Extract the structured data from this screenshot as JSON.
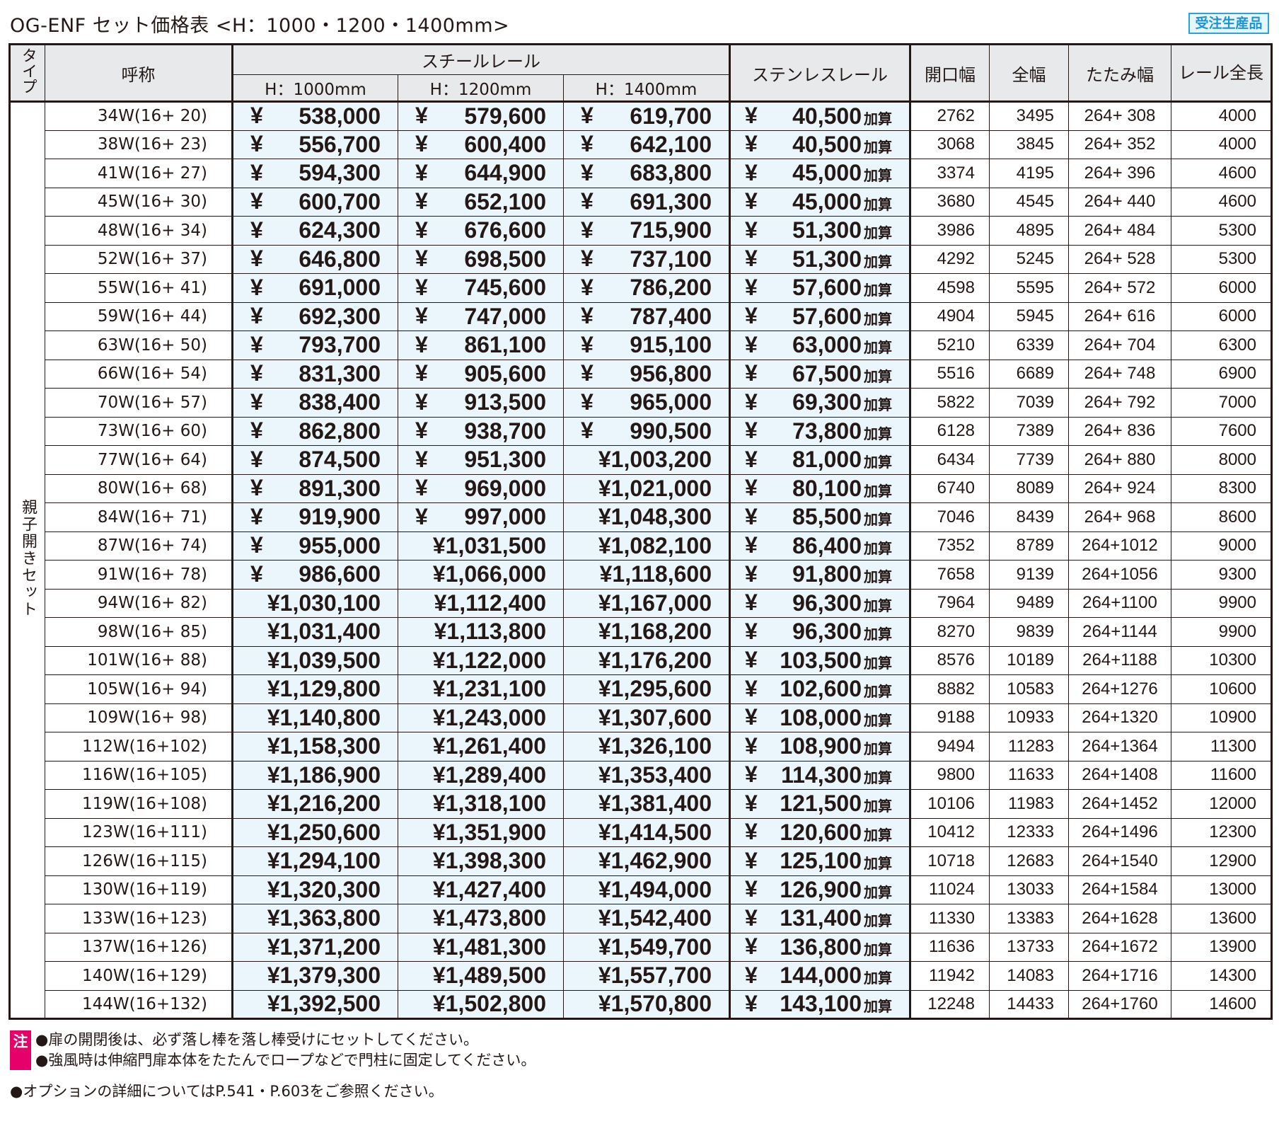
{
  "title": "OG-ENF セット価格表 <H：1000・1200・1400mm>",
  "badge": "受注生産品",
  "header": {
    "type": "タイプ",
    "name": "呼称",
    "steel_rail": "スチールレール",
    "h1000": "H：1000mm",
    "h1200": "H：1200mm",
    "h1400": "H：1400mm",
    "stainless_rail": "ステンレスレール",
    "opening_width": "開口幅",
    "total_width": "全幅",
    "folded_width": "たたみ幅",
    "rail_length": "レール全長"
  },
  "type_label": "親子開きセット",
  "currency": "¥",
  "kasan": "加算",
  "rows": [
    {
      "name": "34W(16+ 20)",
      "h1000": "538,000",
      "h1200": "579,600",
      "h1400": "619,700",
      "stainless": "40,500",
      "opening": "2762",
      "total": "3495",
      "folded": "264+ 308",
      "rail": "4000"
    },
    {
      "name": "38W(16+ 23)",
      "h1000": "556,700",
      "h1200": "600,400",
      "h1400": "642,100",
      "stainless": "40,500",
      "opening": "3068",
      "total": "3845",
      "folded": "264+ 352",
      "rail": "4000"
    },
    {
      "name": "41W(16+ 27)",
      "h1000": "594,300",
      "h1200": "644,900",
      "h1400": "683,800",
      "stainless": "45,000",
      "opening": "3374",
      "total": "4195",
      "folded": "264+ 396",
      "rail": "4600"
    },
    {
      "name": "45W(16+ 30)",
      "h1000": "600,700",
      "h1200": "652,100",
      "h1400": "691,300",
      "stainless": "45,000",
      "opening": "3680",
      "total": "4545",
      "folded": "264+ 440",
      "rail": "4600"
    },
    {
      "name": "48W(16+ 34)",
      "h1000": "624,300",
      "h1200": "676,600",
      "h1400": "715,900",
      "stainless": "51,300",
      "opening": "3986",
      "total": "4895",
      "folded": "264+ 484",
      "rail": "5300"
    },
    {
      "name": "52W(16+ 37)",
      "h1000": "646,800",
      "h1200": "698,500",
      "h1400": "737,100",
      "stainless": "51,300",
      "opening": "4292",
      "total": "5245",
      "folded": "264+ 528",
      "rail": "5300"
    },
    {
      "name": "55W(16+ 41)",
      "h1000": "691,000",
      "h1200": "745,600",
      "h1400": "786,200",
      "stainless": "57,600",
      "opening": "4598",
      "total": "5595",
      "folded": "264+ 572",
      "rail": "6000"
    },
    {
      "name": "59W(16+ 44)",
      "h1000": "692,300",
      "h1200": "747,000",
      "h1400": "787,400",
      "stainless": "57,600",
      "opening": "4904",
      "total": "5945",
      "folded": "264+ 616",
      "rail": "6000"
    },
    {
      "name": "63W(16+ 50)",
      "h1000": "793,700",
      "h1200": "861,100",
      "h1400": "915,100",
      "stainless": "63,000",
      "opening": "5210",
      "total": "6339",
      "folded": "264+ 704",
      "rail": "6300"
    },
    {
      "name": "66W(16+ 54)",
      "h1000": "831,300",
      "h1200": "905,600",
      "h1400": "956,800",
      "stainless": "67,500",
      "opening": "5516",
      "total": "6689",
      "folded": "264+ 748",
      "rail": "6900"
    },
    {
      "name": "70W(16+ 57)",
      "h1000": "838,400",
      "h1200": "913,500",
      "h1400": "965,000",
      "stainless": "69,300",
      "opening": "5822",
      "total": "7039",
      "folded": "264+ 792",
      "rail": "7000"
    },
    {
      "name": "73W(16+ 60)",
      "h1000": "862,800",
      "h1200": "938,700",
      "h1400": "990,500",
      "stainless": "73,800",
      "opening": "6128",
      "total": "7389",
      "folded": "264+ 836",
      "rail": "7600"
    },
    {
      "name": "77W(16+ 64)",
      "h1000": "874,500",
      "h1200": "951,300",
      "h1400": "1,003,200",
      "stainless": "81,000",
      "opening": "6434",
      "total": "7739",
      "folded": "264+ 880",
      "rail": "8000"
    },
    {
      "name": "80W(16+ 68)",
      "h1000": "891,300",
      "h1200": "969,000",
      "h1400": "1,021,000",
      "stainless": "80,100",
      "opening": "6740",
      "total": "8089",
      "folded": "264+ 924",
      "rail": "8300"
    },
    {
      "name": "84W(16+ 71)",
      "h1000": "919,900",
      "h1200": "997,000",
      "h1400": "1,048,300",
      "stainless": "85,500",
      "opening": "7046",
      "total": "8439",
      "folded": "264+ 968",
      "rail": "8600"
    },
    {
      "name": "87W(16+ 74)",
      "h1000": "955,000",
      "h1200": "1,031,500",
      "h1400": "1,082,100",
      "stainless": "86,400",
      "opening": "7352",
      "total": "8789",
      "folded": "264+1012",
      "rail": "9000"
    },
    {
      "name": "91W(16+ 78)",
      "h1000": "986,600",
      "h1200": "1,066,000",
      "h1400": "1,118,600",
      "stainless": "91,800",
      "opening": "7658",
      "total": "9139",
      "folded": "264+1056",
      "rail": "9300"
    },
    {
      "name": "94W(16+ 82)",
      "h1000": "1,030,100",
      "h1200": "1,112,400",
      "h1400": "1,167,000",
      "stainless": "96,300",
      "opening": "7964",
      "total": "9489",
      "folded": "264+1100",
      "rail": "9900"
    },
    {
      "name": "98W(16+ 85)",
      "h1000": "1,031,400",
      "h1200": "1,113,800",
      "h1400": "1,168,200",
      "stainless": "96,300",
      "opening": "8270",
      "total": "9839",
      "folded": "264+1144",
      "rail": "9900"
    },
    {
      "name": "101W(16+ 88)",
      "h1000": "1,039,500",
      "h1200": "1,122,000",
      "h1400": "1,176,200",
      "stainless": "103,500",
      "opening": "8576",
      "total": "10189",
      "folded": "264+1188",
      "rail": "10300"
    },
    {
      "name": "105W(16+ 94)",
      "h1000": "1,129,800",
      "h1200": "1,231,100",
      "h1400": "1,295,600",
      "stainless": "102,600",
      "opening": "8882",
      "total": "10583",
      "folded": "264+1276",
      "rail": "10600"
    },
    {
      "name": "109W(16+ 98)",
      "h1000": "1,140,800",
      "h1200": "1,243,000",
      "h1400": "1,307,600",
      "stainless": "108,000",
      "opening": "9188",
      "total": "10933",
      "folded": "264+1320",
      "rail": "10900"
    },
    {
      "name": "112W(16+102)",
      "h1000": "1,158,300",
      "h1200": "1,261,400",
      "h1400": "1,326,100",
      "stainless": "108,900",
      "opening": "9494",
      "total": "11283",
      "folded": "264+1364",
      "rail": "11300"
    },
    {
      "name": "116W(16+105)",
      "h1000": "1,186,900",
      "h1200": "1,289,400",
      "h1400": "1,353,400",
      "stainless": "114,300",
      "opening": "9800",
      "total": "11633",
      "folded": "264+1408",
      "rail": "11600"
    },
    {
      "name": "119W(16+108)",
      "h1000": "1,216,200",
      "h1200": "1,318,100",
      "h1400": "1,381,400",
      "stainless": "121,500",
      "opening": "10106",
      "total": "11983",
      "folded": "264+1452",
      "rail": "12000"
    },
    {
      "name": "123W(16+111)",
      "h1000": "1,250,600",
      "h1200": "1,351,900",
      "h1400": "1,414,500",
      "stainless": "120,600",
      "opening": "10412",
      "total": "12333",
      "folded": "264+1496",
      "rail": "12300"
    },
    {
      "name": "126W(16+115)",
      "h1000": "1,294,100",
      "h1200": "1,398,300",
      "h1400": "1,462,900",
      "stainless": "125,100",
      "opening": "10718",
      "total": "12683",
      "folded": "264+1540",
      "rail": "12900"
    },
    {
      "name": "130W(16+119)",
      "h1000": "1,320,300",
      "h1200": "1,427,400",
      "h1400": "1,494,000",
      "stainless": "126,900",
      "opening": "11024",
      "total": "13033",
      "folded": "264+1584",
      "rail": "13000"
    },
    {
      "name": "133W(16+123)",
      "h1000": "1,363,800",
      "h1200": "1,473,800",
      "h1400": "1,542,400",
      "stainless": "131,400",
      "opening": "11330",
      "total": "13383",
      "folded": "264+1628",
      "rail": "13600"
    },
    {
      "name": "137W(16+126)",
      "h1000": "1,371,200",
      "h1200": "1,481,300",
      "h1400": "1,549,700",
      "stainless": "136,800",
      "opening": "11636",
      "total": "13733",
      "folded": "264+1672",
      "rail": "13900"
    },
    {
      "name": "140W(16+129)",
      "h1000": "1,379,300",
      "h1200": "1,489,500",
      "h1400": "1,557,700",
      "stainless": "144,000",
      "opening": "11942",
      "total": "14083",
      "folded": "264+1716",
      "rail": "14300"
    },
    {
      "name": "144W(16+132)",
      "h1000": "1,392,500",
      "h1200": "1,502,800",
      "h1400": "1,570,800",
      "stainless": "143,100",
      "opening": "12248",
      "total": "14433",
      "folded": "264+1760",
      "rail": "14600"
    }
  ],
  "notes": {
    "label": "注",
    "items": [
      "●扉の開閉後は、必ず落し棒を落し棒受けにセットしてください。",
      "●強風時は伸縮門扉本体をたたんでロープなどで門柱に固定してください。"
    ],
    "option": "●オプションの詳細についてはP.541・P.603をご参照ください。"
  }
}
